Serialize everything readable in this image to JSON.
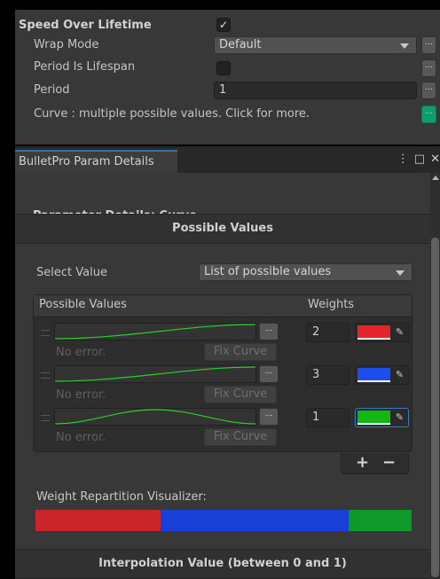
{
  "inspector": {
    "speed_over_lifetime": {
      "label": "Speed Over Lifetime",
      "checked": true
    },
    "wrap_mode": {
      "label": "Wrap Mode",
      "value": "Default"
    },
    "period_is_lifespan": {
      "label": "Period Is Lifespan",
      "checked": false
    },
    "period": {
      "label": "Period",
      "value": "1"
    },
    "curve_note": "Curve : multiple possible values. Click for more.",
    "more_button": "..."
  },
  "panel": {
    "tab_title": "BulletPro Param Details",
    "icons": [
      "kebab-menu-icon",
      "maximize-icon",
      "close-icon"
    ],
    "heading": "Parameter Details: Curve",
    "section_possible_values": "Possible Values",
    "select_value": {
      "label": "Select Value",
      "value": "List of possible values"
    },
    "list": {
      "col_values": "Possible Values",
      "col_weights": "Weights",
      "entries": [
        {
          "curve": "ease-in-out rising",
          "error": "No error.",
          "fix_label": "Fix Curve",
          "weight": "2",
          "color": "#e8232a",
          "selected": false
        },
        {
          "curve": "ease-in-out rising",
          "error": "No error.",
          "fix_label": "Fix Curve",
          "weight": "3",
          "color": "#1d4ef0",
          "selected": false
        },
        {
          "curve": "bell",
          "error": "No error.",
          "fix_label": "Fix Curve",
          "weight": "1",
          "color": "#12b812",
          "selected": true
        }
      ],
      "add_label": "+",
      "remove_label": "−",
      "dots_label": "..."
    },
    "weight_visualizer": {
      "label": "Weight Repartition Visualizer:",
      "segments": [
        {
          "weight": 2,
          "color": "#c8242a"
        },
        {
          "weight": 3,
          "color": "#1a3fd8"
        },
        {
          "weight": 1,
          "color": "#0e9a2a"
        }
      ]
    },
    "section_interpolation": "Interpolation Value (between 0 and 1)"
  }
}
